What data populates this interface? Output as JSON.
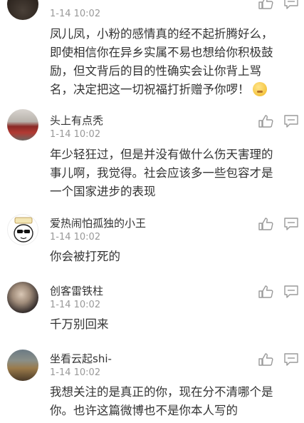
{
  "colors": {
    "name": "#333333",
    "time": "#999999",
    "icon": "#9a9a9a"
  },
  "comments": [
    {
      "name": "",
      "time": "1-14 10:02",
      "lines": [
        "凤儿凤，小粉的感情真的经不起折腾好么，",
        "即使相信你在异乡实属不易也想给你积极鼓",
        "励，但文背后的目的性确实会让你背上骂",
        "名，决定把这一切祝福打折赠予你啰！"
      ],
      "trailing_icon": "smile-emoji-icon"
    },
    {
      "name": "头上有点秃",
      "time": "1-14 10:02",
      "lines": [
        "年少轻狂过，但是并没有做什么伤天害理的",
        "事儿啊，我觉得。社会应该多一些包容才是",
        "一个国家进步的表现"
      ]
    },
    {
      "name": "爱热闹怕孤独的小王",
      "time": "1-14 10:02",
      "lines": [
        "你会被打死的"
      ]
    },
    {
      "name": "创客雷铁柱",
      "time": "1-14 10:02",
      "lines": [
        "千万别回来"
      ]
    },
    {
      "name": "坐看云起shi-",
      "time": "1-14 10:02",
      "lines": [
        "我想关注的是真正的你，现在分不清哪个是",
        "你。也许这篇微博也不是你本人写的"
      ]
    }
  ]
}
